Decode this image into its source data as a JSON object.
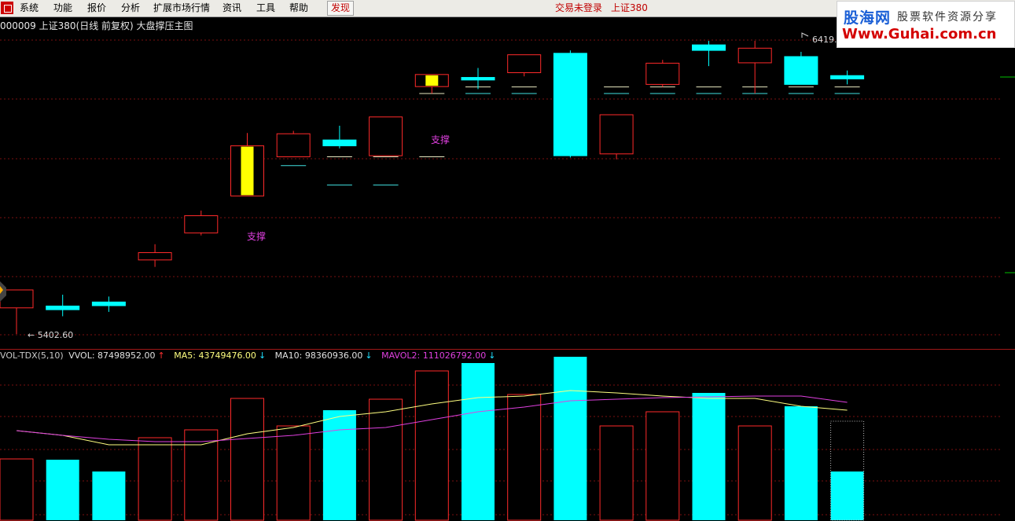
{
  "menu": {
    "items": [
      "系统",
      "功能",
      "报价",
      "分析",
      "扩展市场行情",
      "资讯",
      "工具",
      "帮助"
    ],
    "discover": "发现",
    "status_login": "交易未登录",
    "status_index": "上证380"
  },
  "watermark": {
    "brand": "股海网",
    "slogan": "股票软件资源分享",
    "url": "Www.Guhai.com.cn"
  },
  "chart_title": "000009 上证380(日线 前复权) 大盘撑压主图",
  "indicator": {
    "name": "VOL-TDX(5,10)",
    "vol": "VVOL: 87498952.00",
    "ma5": "MA5: 43749476.00",
    "ma10": "MA10: 98360936.00",
    "mavol2": "MAVOL2: 111026792.00"
  },
  "colors": {
    "up": "#ff2a2a",
    "down": "#00ffff",
    "ma_yellow": "#ffff80",
    "ma_magenta": "#e040e0",
    "grid": "#7a1010",
    "support_text": "#e040e0"
  },
  "chart_data": [
    {
      "type": "candlestick",
      "high_label": "6419.4",
      "low_label": "5402.60",
      "annotations": [
        "支撑",
        "支撑"
      ],
      "candles": [
        {
          "open": 5474,
          "close": 5523,
          "high": 5523,
          "low": 5402.6,
          "color": "up"
        },
        {
          "open": 5479,
          "close": 5469,
          "high": 5510,
          "low": 5451,
          "color": "down"
        },
        {
          "open": 5490,
          "close": 5480,
          "high": 5505,
          "low": 5463,
          "color": "down"
        },
        {
          "open": 5605,
          "close": 5625,
          "high": 5648,
          "low": 5586,
          "color": "up"
        },
        {
          "open": 5679,
          "close": 5726,
          "high": 5740,
          "low": 5672,
          "color": "up"
        },
        {
          "open": 5780,
          "close": 5917,
          "high": 5952,
          "low": 5780,
          "color": "up",
          "fill": "yellow"
        },
        {
          "open": 5887,
          "close": 5950,
          "high": 5958,
          "low": 5887,
          "color": "up"
        },
        {
          "open": 5917,
          "close": 5933,
          "high": 5972,
          "low": 5910,
          "color": "down"
        },
        {
          "open": 5890,
          "close": 5996,
          "high": 5996,
          "low": 5890,
          "color": "up"
        },
        {
          "open": 6079,
          "close": 6112,
          "high": 6112,
          "low": 6060,
          "color": "up",
          "fill": "yellow"
        },
        {
          "open": 6104,
          "close": 6097,
          "high": 6130,
          "low": 6072,
          "color": "down"
        },
        {
          "open": 6117,
          "close": 6166,
          "high": 6166,
          "low": 6107,
          "color": "up"
        },
        {
          "open": 6170,
          "close": 5890,
          "high": 6178,
          "low": 5885,
          "color": "down"
        },
        {
          "open": 5895,
          "close": 6002,
          "high": 6002,
          "low": 5880,
          "color": "up"
        },
        {
          "open": 6085,
          "close": 6143,
          "high": 6152,
          "low": 6078,
          "color": "up"
        },
        {
          "open": 6193,
          "close": 6178,
          "high": 6204,
          "low": 6135,
          "color": "down"
        },
        {
          "open": 6144,
          "close": 6184,
          "high": 6204,
          "low": 6060,
          "color": "up"
        },
        {
          "open": 6161,
          "close": 6085,
          "high": 6174,
          "low": 6097,
          "color": "down"
        },
        {
          "open": 6109,
          "close": 6100,
          "high": 6123,
          "low": 6085,
          "color": "down"
        }
      ],
      "support_lines": [
        {
          "from": 6,
          "to": 9,
          "pairs": [
            [
              5887,
              5863
            ],
            [
              5887,
              5810
            ],
            [
              5887,
              5810
            ],
            [
              5887
            ]
          ]
        },
        {
          "from": 9,
          "to": 18,
          "pairs": [
            [
              6060
            ],
            [
              6078,
              6060
            ],
            [
              6078,
              6060
            ],
            [
              6078,
              6060
            ],
            [
              6078,
              6060
            ],
            [
              6078,
              6060
            ],
            [
              6078,
              6060
            ],
            [
              6078,
              6060
            ],
            [
              6078,
              6060
            ],
            [
              6078,
              6060
            ]
          ]
        }
      ]
    },
    {
      "type": "bar",
      "volumes": [
        78,
        77,
        62,
        105,
        115,
        155,
        120,
        140,
        154,
        190,
        200,
        160,
        208,
        120,
        138,
        162,
        120,
        145,
        62
      ],
      "volume_outline_last": 126,
      "ma_yellow": [
        114,
        108,
        96,
        96,
        96,
        110,
        118,
        132,
        138,
        148,
        156,
        158,
        165,
        162,
        158,
        155,
        155,
        145,
        140
      ],
      "ma_magenta": [
        114,
        108,
        103,
        100,
        100,
        104,
        108,
        115,
        118,
        128,
        138,
        144,
        152,
        154,
        156,
        157,
        158,
        158,
        150
      ]
    }
  ]
}
